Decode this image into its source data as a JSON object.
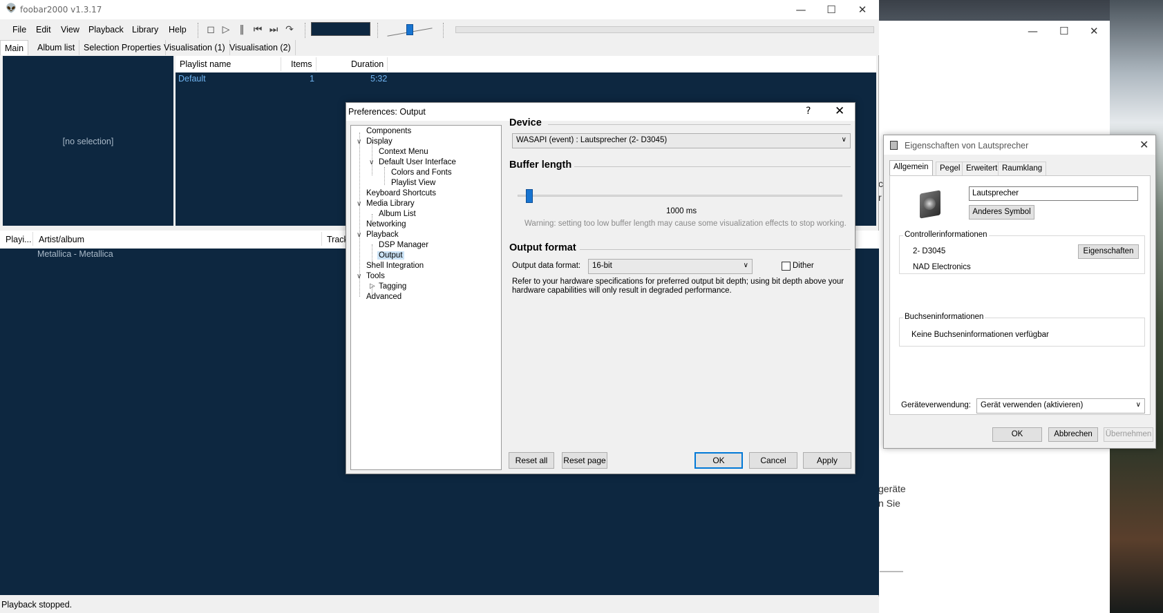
{
  "foobar": {
    "title": "foobar2000 v1.3.17",
    "menu": [
      "File",
      "Edit",
      "View",
      "Playback",
      "Library",
      "Help"
    ],
    "tabs": [
      "Main",
      "Album list",
      "Selection Properties",
      "Visualisation (1)",
      "Visualisation (2)"
    ],
    "no_selection": "[no selection]",
    "playlist_manager": {
      "columns": [
        "Playlist name",
        "Items",
        "Duration"
      ],
      "rows": [
        {
          "name": "Default",
          "items": "1",
          "duration": "5:32"
        }
      ]
    },
    "playlist_view": {
      "columns": [
        "Playi...",
        "Artist/album",
        "Track"
      ],
      "group_row": "Metallica - Metallica"
    },
    "status": "Playback stopped.",
    "toolbar_icons": [
      "stop-icon",
      "play-icon",
      "pause-icon",
      "previous-icon",
      "next-icon",
      "random-icon"
    ]
  },
  "prefs": {
    "title": "Preferences: Output",
    "help_glyph": "?",
    "tree": [
      {
        "label": "Components"
      },
      {
        "label": "Display"
      },
      {
        "label": "Context Menu"
      },
      {
        "label": "Default User Interface"
      },
      {
        "label": "Colors and Fonts"
      },
      {
        "label": "Playlist View"
      },
      {
        "label": "Keyboard Shortcuts"
      },
      {
        "label": "Media Library"
      },
      {
        "label": "Album List"
      },
      {
        "label": "Networking"
      },
      {
        "label": "Playback"
      },
      {
        "label": "DSP Manager"
      },
      {
        "label": "Output"
      },
      {
        "label": "Shell Integration"
      },
      {
        "label": "Tools"
      },
      {
        "label": "Tagging"
      },
      {
        "label": "Advanced"
      }
    ],
    "device": {
      "heading": "Device",
      "value": "WASAPI (event) : Lautsprecher (2- D3045)"
    },
    "buffer": {
      "heading": "Buffer length",
      "value": "1000 ms",
      "warning": "Warning: setting too low buffer length may cause some visualization effects to stop working."
    },
    "output_format": {
      "heading": "Output format",
      "label": "Output data format:",
      "value": "16-bit",
      "dither_label": "Dither",
      "dither_checked": false,
      "note": "Refer to your hardware specifications for preferred output bit depth; using bit depth above your hardware capabilities will only result in degraded performance."
    },
    "buttons": {
      "reset_all": "Reset all",
      "reset_page": "Reset page",
      "ok": "OK",
      "cancel": "Cancel",
      "apply": "Apply"
    }
  },
  "speaker_props": {
    "title": "Eigenschaften von Lautsprecher",
    "tabs": [
      "Allgemein",
      "Pegel",
      "Erweitert",
      "Raumklang"
    ],
    "name_value": "Lautsprecher",
    "change_icon": "Anderes Symbol",
    "controller": {
      "legend": "Controllerinformationen",
      "name": "2- D3045",
      "vendor": "NAD Electronics",
      "props_button": "Eigenschaften"
    },
    "jack": {
      "legend": "Buchseninformationen",
      "text": "Keine Buchseninformationen verfügbar"
    },
    "usage_label": "Geräteverwendung:",
    "usage_value": "Gerät verwenden (aktivieren)",
    "buttons": {
      "ok": "OK",
      "cancel": "Abbrechen",
      "apply": "Übernehmen"
    }
  },
  "background_window": {
    "line1": "geräte",
    "line2": "n Sie",
    "side_a": "c",
    "side_b": "r"
  }
}
